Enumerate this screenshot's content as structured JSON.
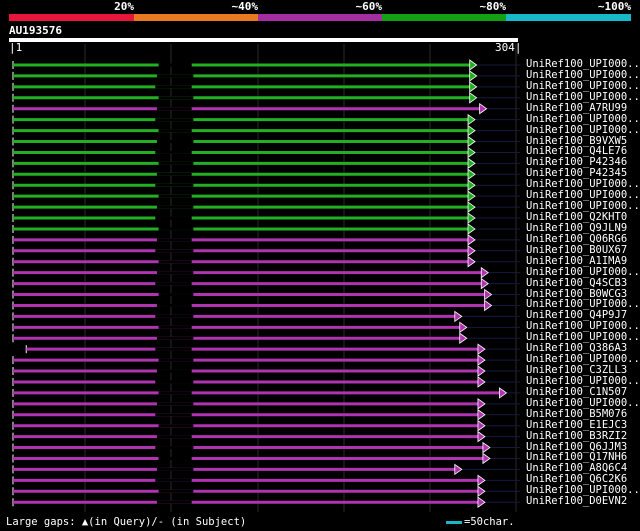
{
  "scale": {
    "labels": [
      "20%",
      "~40%",
      "~60%",
      "~80%",
      "~100%"
    ],
    "colors": [
      "#e8163a",
      "#ea7a22",
      "#a22ea0",
      "#14a014",
      "#17b8c8"
    ]
  },
  "query": {
    "name": "AU193576",
    "start_label": "1",
    "end_label": "304",
    "length": 304
  },
  "colors": {
    "green": "#22b022",
    "magenta": "#b033b0",
    "gap": "#151a3e",
    "grid": "#2a2a2a"
  },
  "hits": [
    {
      "name": "UniRef100_UPI000..",
      "color": "green",
      "end": 276
    },
    {
      "name": "UniRef100_UPI000..",
      "color": "green",
      "end": 276
    },
    {
      "name": "UniRef100_UPI000..",
      "color": "green",
      "end": 276
    },
    {
      "name": "UniRef100_UPI000..",
      "color": "green",
      "end": 276
    },
    {
      "name": "UniRef100_A7RU99",
      "color": "magenta",
      "end": 282
    },
    {
      "name": "UniRef100_UPI000..",
      "color": "green",
      "end": 275
    },
    {
      "name": "UniRef100_UPI000..",
      "color": "green",
      "end": 275
    },
    {
      "name": "UniRef100_B9VXW5",
      "color": "green",
      "end": 275
    },
    {
      "name": "UniRef100_Q4LE76",
      "color": "green",
      "end": 275
    },
    {
      "name": "UniRef100_P42346",
      "color": "green",
      "end": 275
    },
    {
      "name": "UniRef100_P42345",
      "color": "green",
      "end": 275
    },
    {
      "name": "UniRef100_UPI000..",
      "color": "green",
      "end": 275
    },
    {
      "name": "UniRef100_UPI000..",
      "color": "green",
      "end": 275
    },
    {
      "name": "UniRef100_UPI000..",
      "color": "green",
      "end": 275
    },
    {
      "name": "UniRef100_Q2KHT0",
      "color": "green",
      "end": 275
    },
    {
      "name": "UniRef100_Q9JLN9",
      "color": "green",
      "end": 275
    },
    {
      "name": "UniRef100_Q06RG6",
      "color": "magenta",
      "end": 275
    },
    {
      "name": "UniRef100_B0UX67",
      "color": "magenta",
      "end": 275
    },
    {
      "name": "UniRef100_A1IMA9",
      "color": "magenta",
      "end": 275
    },
    {
      "name": "UniRef100_UPI000..",
      "color": "magenta",
      "end": 283
    },
    {
      "name": "UniRef100_Q4SCB3",
      "color": "magenta",
      "end": 283
    },
    {
      "name": "UniRef100_B0WCG3",
      "color": "magenta",
      "end": 285
    },
    {
      "name": "UniRef100_UPI000..",
      "color": "magenta",
      "end": 285
    },
    {
      "name": "UniRef100_Q4P9J7",
      "color": "magenta",
      "end": 267
    },
    {
      "name": "UniRef100_UPI000..",
      "color": "magenta",
      "end": 270
    },
    {
      "name": "UniRef100_UPI000..",
      "color": "magenta",
      "end": 270
    },
    {
      "name": "UniRef100_Q386A3",
      "color": "magenta",
      "end": 281,
      "start": 8
    },
    {
      "name": "UniRef100_UPI000..",
      "color": "magenta",
      "end": 281
    },
    {
      "name": "UniRef100_C3ZLL3",
      "color": "magenta",
      "end": 281
    },
    {
      "name": "UniRef100_UPI000..",
      "color": "magenta",
      "end": 281
    },
    {
      "name": "UniRef100_C1N507",
      "color": "magenta",
      "end": 294
    },
    {
      "name": "UniRef100_UPI000..",
      "color": "magenta",
      "end": 281
    },
    {
      "name": "UniRef100_B5M076",
      "color": "magenta",
      "end": 281
    },
    {
      "name": "UniRef100_E1EJC3",
      "color": "magenta",
      "end": 281
    },
    {
      "name": "UniRef100_B3RZI2",
      "color": "magenta",
      "end": 281
    },
    {
      "name": "UniRef100_Q6JJM3",
      "color": "magenta",
      "end": 284
    },
    {
      "name": "UniRef100_Q17NH6",
      "color": "magenta",
      "end": 284
    },
    {
      "name": "UniRef100_A8Q6C4",
      "color": "magenta",
      "end": 267
    },
    {
      "name": "UniRef100_Q6C2K6",
      "color": "magenta",
      "end": 281
    },
    {
      "name": "UniRef100_UPI000..",
      "color": "magenta",
      "end": 281
    },
    {
      "name": "UniRef100_D0EVN2",
      "color": "magenta",
      "end": 281
    }
  ],
  "legend": {
    "gaps_text": "Large gaps: ▲(in Query)/- (in Subject)",
    "scale_text": "=50char."
  }
}
